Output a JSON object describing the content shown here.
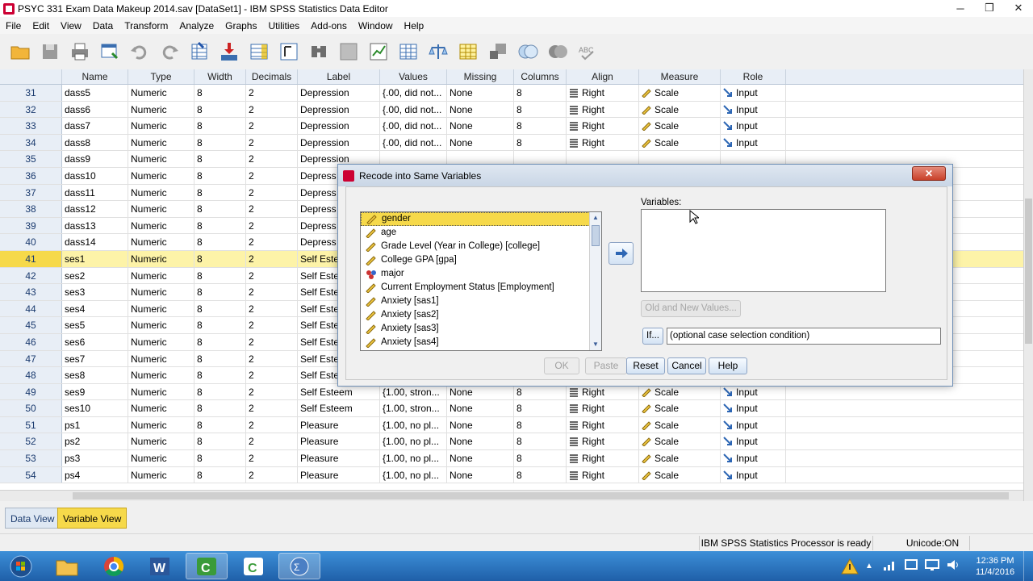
{
  "window": {
    "title": "PSYC 331 Exam Data Makeup 2014.sav [DataSet1] - IBM SPSS Statistics Data Editor",
    "controls": [
      "minimize",
      "maximize",
      "close"
    ]
  },
  "menu": [
    "File",
    "Edit",
    "View",
    "Data",
    "Transform",
    "Analyze",
    "Graphs",
    "Utilities",
    "Add-ons",
    "Window",
    "Help"
  ],
  "toolbar_icons": [
    "open-folder-icon",
    "save-icon",
    "print-icon",
    "dialog-recall-icon",
    "undo-icon",
    "redo-icon",
    "goto-case-icon",
    "goto-variable-icon",
    "variables-icon",
    "value-labels-icon",
    "find-icon",
    "insert-cases-icon",
    "insert-variable-icon",
    "split-file-icon",
    "weight-cases-icon",
    "select-cases-icon",
    "use-sets-icon",
    "show-all-icon",
    "spelling-icon"
  ],
  "grid": {
    "columns": [
      "",
      "Name",
      "Type",
      "Width",
      "Decimals",
      "Label",
      "Values",
      "Missing",
      "Columns",
      "Align",
      "Measure",
      "Role"
    ],
    "rows": [
      {
        "n": "31",
        "name": "dass5",
        "type": "Numeric",
        "width": "8",
        "dec": "2",
        "label": "Depression",
        "values": "{.00, did not...",
        "missing": "None",
        "cols": "8",
        "align": "Right",
        "measure": "Scale",
        "role": "Input"
      },
      {
        "n": "32",
        "name": "dass6",
        "type": "Numeric",
        "width": "8",
        "dec": "2",
        "label": "Depression",
        "values": "{.00, did not...",
        "missing": "None",
        "cols": "8",
        "align": "Right",
        "measure": "Scale",
        "role": "Input"
      },
      {
        "n": "33",
        "name": "dass7",
        "type": "Numeric",
        "width": "8",
        "dec": "2",
        "label": "Depression",
        "values": "{.00, did not...",
        "missing": "None",
        "cols": "8",
        "align": "Right",
        "measure": "Scale",
        "role": "Input"
      },
      {
        "n": "34",
        "name": "dass8",
        "type": "Numeric",
        "width": "8",
        "dec": "2",
        "label": "Depression",
        "values": "{.00, did not...",
        "missing": "None",
        "cols": "8",
        "align": "Right",
        "measure": "Scale",
        "role": "Input"
      },
      {
        "n": "35",
        "name": "dass9",
        "type": "Numeric",
        "width": "8",
        "dec": "2",
        "label": "Depression",
        "values": "",
        "missing": "",
        "cols": "",
        "align": "",
        "measure": "",
        "role": ""
      },
      {
        "n": "36",
        "name": "dass10",
        "type": "Numeric",
        "width": "8",
        "dec": "2",
        "label": "Depress",
        "values": "",
        "missing": "",
        "cols": "",
        "align": "",
        "measure": "",
        "role": ""
      },
      {
        "n": "37",
        "name": "dass11",
        "type": "Numeric",
        "width": "8",
        "dec": "2",
        "label": "Depress",
        "values": "",
        "missing": "",
        "cols": "",
        "align": "",
        "measure": "",
        "role": ""
      },
      {
        "n": "38",
        "name": "dass12",
        "type": "Numeric",
        "width": "8",
        "dec": "2",
        "label": "Depress",
        "values": "",
        "missing": "",
        "cols": "",
        "align": "",
        "measure": "",
        "role": ""
      },
      {
        "n": "39",
        "name": "dass13",
        "type": "Numeric",
        "width": "8",
        "dec": "2",
        "label": "Depress",
        "values": "",
        "missing": "",
        "cols": "",
        "align": "",
        "measure": "",
        "role": ""
      },
      {
        "n": "40",
        "name": "dass14",
        "type": "Numeric",
        "width": "8",
        "dec": "2",
        "label": "Depress",
        "values": "",
        "missing": "",
        "cols": "",
        "align": "",
        "measure": "",
        "role": ""
      },
      {
        "n": "41",
        "name": "ses1",
        "type": "Numeric",
        "width": "8",
        "dec": "2",
        "label": "Self Este",
        "values": "",
        "missing": "",
        "cols": "",
        "align": "",
        "measure": "",
        "role": "",
        "selected": true
      },
      {
        "n": "42",
        "name": "ses2",
        "type": "Numeric",
        "width": "8",
        "dec": "2",
        "label": "Self Este",
        "values": "",
        "missing": "",
        "cols": "",
        "align": "",
        "measure": "",
        "role": ""
      },
      {
        "n": "43",
        "name": "ses3",
        "type": "Numeric",
        "width": "8",
        "dec": "2",
        "label": "Self Este",
        "values": "",
        "missing": "",
        "cols": "",
        "align": "",
        "measure": "",
        "role": ""
      },
      {
        "n": "44",
        "name": "ses4",
        "type": "Numeric",
        "width": "8",
        "dec": "2",
        "label": "Self Este",
        "values": "",
        "missing": "",
        "cols": "",
        "align": "",
        "measure": "",
        "role": ""
      },
      {
        "n": "45",
        "name": "ses5",
        "type": "Numeric",
        "width": "8",
        "dec": "2",
        "label": "Self Este",
        "values": "",
        "missing": "",
        "cols": "",
        "align": "",
        "measure": "",
        "role": ""
      },
      {
        "n": "46",
        "name": "ses6",
        "type": "Numeric",
        "width": "8",
        "dec": "2",
        "label": "Self Este",
        "values": "",
        "missing": "",
        "cols": "",
        "align": "",
        "measure": "",
        "role": ""
      },
      {
        "n": "47",
        "name": "ses7",
        "type": "Numeric",
        "width": "8",
        "dec": "2",
        "label": "Self Este",
        "values": "",
        "missing": "",
        "cols": "",
        "align": "",
        "measure": "",
        "role": ""
      },
      {
        "n": "48",
        "name": "ses8",
        "type": "Numeric",
        "width": "8",
        "dec": "2",
        "label": "Self Este",
        "values": "",
        "missing": "",
        "cols": "",
        "align": "",
        "measure": "",
        "role": ""
      },
      {
        "n": "49",
        "name": "ses9",
        "type": "Numeric",
        "width": "8",
        "dec": "2",
        "label": "Self Esteem",
        "values": "{1.00, stron...",
        "missing": "None",
        "cols": "8",
        "align": "Right",
        "measure": "Scale",
        "role": "Input"
      },
      {
        "n": "50",
        "name": "ses10",
        "type": "Numeric",
        "width": "8",
        "dec": "2",
        "label": "Self Esteem",
        "values": "{1.00, stron...",
        "missing": "None",
        "cols": "8",
        "align": "Right",
        "measure": "Scale",
        "role": "Input"
      },
      {
        "n": "51",
        "name": "ps1",
        "type": "Numeric",
        "width": "8",
        "dec": "2",
        "label": "Pleasure",
        "values": "{1.00, no pl...",
        "missing": "None",
        "cols": "8",
        "align": "Right",
        "measure": "Scale",
        "role": "Input"
      },
      {
        "n": "52",
        "name": "ps2",
        "type": "Numeric",
        "width": "8",
        "dec": "2",
        "label": "Pleasure",
        "values": "{1.00, no pl...",
        "missing": "None",
        "cols": "8",
        "align": "Right",
        "measure": "Scale",
        "role": "Input"
      },
      {
        "n": "53",
        "name": "ps3",
        "type": "Numeric",
        "width": "8",
        "dec": "2",
        "label": "Pleasure",
        "values": "{1.00, no pl...",
        "missing": "None",
        "cols": "8",
        "align": "Right",
        "measure": "Scale",
        "role": "Input"
      },
      {
        "n": "54",
        "name": "ps4",
        "type": "Numeric",
        "width": "8",
        "dec": "2",
        "label": "Pleasure",
        "values": "{1.00, no pl...",
        "missing": "None",
        "cols": "8",
        "align": "Right",
        "measure": "Scale",
        "role": "Input"
      }
    ]
  },
  "tabs": {
    "data_view": "Data View",
    "variable_view": "Variable View"
  },
  "status": {
    "processor": "IBM SPSS Statistics Processor is ready",
    "unicode": "Unicode:ON"
  },
  "taskbar": {
    "apps": [
      "start-orb-icon",
      "file-explorer-icon",
      "chrome-icon",
      "word-icon",
      "camtasia-recorder-icon",
      "camtasia-studio-icon",
      "spss-icon"
    ],
    "time": "12:36 PM",
    "date": "11/4/2016"
  },
  "dialog": {
    "title": "Recode into Same Variables",
    "source_variables": [
      {
        "label": "gender",
        "kind": "scale"
      },
      {
        "label": "age",
        "kind": "scale"
      },
      {
        "label": "Grade Level (Year in College) [college]",
        "kind": "scale"
      },
      {
        "label": "College GPA [gpa]",
        "kind": "scale"
      },
      {
        "label": "major",
        "kind": "nominal"
      },
      {
        "label": "Current Employment Status [Employment]",
        "kind": "scale"
      },
      {
        "label": "Anxiety [sas1]",
        "kind": "scale"
      },
      {
        "label": "Anxiety [sas2]",
        "kind": "scale"
      },
      {
        "label": "Anxiety [sas3]",
        "kind": "scale"
      },
      {
        "label": "Anxiety [sas4]",
        "kind": "scale"
      }
    ],
    "selected_source": "gender",
    "variables_label": "Variables:",
    "old_new_button": "Old and New Values...",
    "if_button": "If...",
    "if_condition": "(optional case selection condition)",
    "buttons": {
      "ok": "OK",
      "paste": "Paste",
      "reset": "Reset",
      "cancel": "Cancel",
      "help": "Help"
    }
  }
}
